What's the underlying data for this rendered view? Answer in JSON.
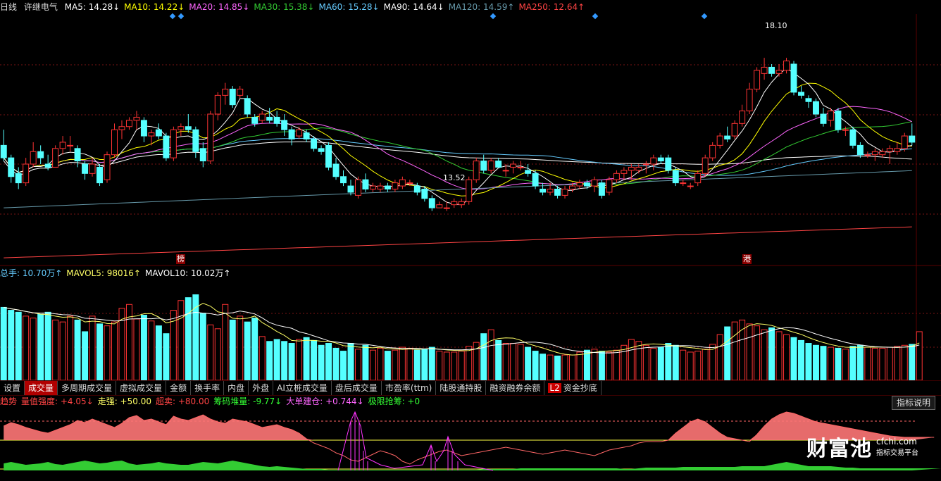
{
  "main_legend": {
    "label": "日线",
    "name": "许继电气",
    "items": [
      {
        "text": "MA5: 14.28↓",
        "color": "#ffffff"
      },
      {
        "text": "MA10: 14.22↓",
        "color": "#ffff00"
      },
      {
        "text": "MA20: 14.85↓",
        "color": "#ff66ff"
      },
      {
        "text": "MA30: 15.38↓",
        "color": "#33cc33"
      },
      {
        "text": "MA60: 15.28↓",
        "color": "#66ccff"
      },
      {
        "text": "MA90: 14.64↓",
        "color": "#ffffff"
      },
      {
        "text": "MA120: 14.59↑",
        "color": "#6699aa"
      },
      {
        "text": "MA250: 12.64↑",
        "color": "#ff4444"
      }
    ]
  },
  "markers": {
    "high": "18.10",
    "low": "13.52",
    "bang": "榜",
    "gang": "港"
  },
  "vol_legend": {
    "items": [
      {
        "text": "总手: 10.70万↑",
        "color": "#66ccff"
      },
      {
        "text": "MAVOL5: 98016↑",
        "color": "#ffff66"
      },
      {
        "text": "MAVOL10: 10.02万↑",
        "color": "#ffffff"
      }
    ]
  },
  "tabs": [
    "设置",
    "成交量",
    "多周期成交量",
    "虚拟成交量",
    "金额",
    "换手率",
    "内盘",
    "外盘",
    "AI立桩成交量",
    "盘后成交量",
    "市盈率(ttm)",
    "陆股通持股",
    "融资融券余额",
    "资金抄底"
  ],
  "tab_l2_badge": "L2",
  "ind_legend": {
    "items": [
      {
        "text": "趋势",
        "color": "#ff4444"
      },
      {
        "text": "量值强度: +4.05↓",
        "color": "#ff4444"
      },
      {
        "text": "走强: +50.00",
        "color": "#ffff66"
      },
      {
        "text": "超卖: +80.00",
        "color": "#ff4444"
      },
      {
        "text": "筹码堆量: -9.77↓",
        "color": "#33ff33"
      },
      {
        "text": "大单建仓: +0.744↓",
        "color": "#ff66ff"
      },
      {
        "text": "极限抢筹: +0",
        "color": "#33ff33"
      }
    ]
  },
  "help_button": "指标说明",
  "logo": {
    "brand": "财富池",
    "site": "cfchi.com",
    "slogan": "指标交易平台"
  },
  "colors": {
    "up": "#ff3333",
    "down": "#55ffff",
    "bg": "#000000"
  },
  "chart_data": [
    {
      "type": "candlestick",
      "title": "许继电气 日线",
      "ylim": [
        11.5,
        19.5
      ],
      "ohlc": [
        [
          15.3,
          15.8,
          14.8,
          14.9
        ],
        [
          14.9,
          15.0,
          14.1,
          14.3
        ],
        [
          14.4,
          14.6,
          13.9,
          14.1
        ],
        [
          14.1,
          14.9,
          14.0,
          14.7
        ],
        [
          14.7,
          15.4,
          14.6,
          15.1
        ],
        [
          15.1,
          15.3,
          14.7,
          14.9
        ],
        [
          14.7,
          15.0,
          14.5,
          14.6
        ],
        [
          14.6,
          15.3,
          14.6,
          15.2
        ],
        [
          15.2,
          15.6,
          15.0,
          15.4
        ],
        [
          15.3,
          15.6,
          15.1,
          15.3
        ],
        [
          15.2,
          15.3,
          14.6,
          14.8
        ],
        [
          14.7,
          14.8,
          14.2,
          14.4
        ],
        [
          14.4,
          14.9,
          14.3,
          14.7
        ],
        [
          14.6,
          14.7,
          14.0,
          14.1
        ],
        [
          14.2,
          15.1,
          14.1,
          15.0
        ],
        [
          15.0,
          16.0,
          14.9,
          15.8
        ],
        [
          15.8,
          16.1,
          15.5,
          15.9
        ],
        [
          15.9,
          16.2,
          15.8,
          16.1
        ],
        [
          16.1,
          16.4,
          15.8,
          16.2
        ],
        [
          16.1,
          16.2,
          15.4,
          15.6
        ],
        [
          15.6,
          15.8,
          15.3,
          15.7
        ],
        [
          15.8,
          16.0,
          15.5,
          15.6
        ],
        [
          15.6,
          15.7,
          14.8,
          14.9
        ],
        [
          14.9,
          15.9,
          14.8,
          15.8
        ],
        [
          15.8,
          16.0,
          15.6,
          15.9
        ],
        [
          15.9,
          16.3,
          15.7,
          15.8
        ],
        [
          15.8,
          15.9,
          14.9,
          15.1
        ],
        [
          15.2,
          15.4,
          14.6,
          14.8
        ],
        [
          14.8,
          16.4,
          14.7,
          16.3
        ],
        [
          16.3,
          17.0,
          16.1,
          16.9
        ],
        [
          16.9,
          17.3,
          16.6,
          17.1
        ],
        [
          17.1,
          17.2,
          16.5,
          16.6
        ],
        [
          16.9,
          17.2,
          16.8,
          17.1
        ],
        [
          16.8,
          16.9,
          16.2,
          16.3
        ],
        [
          16.2,
          16.3,
          15.9,
          16.0
        ],
        [
          16.1,
          16.4,
          16.0,
          16.3
        ],
        [
          16.2,
          16.5,
          16.0,
          16.1
        ],
        [
          16.2,
          16.4,
          15.9,
          16.0
        ],
        [
          16.1,
          16.3,
          15.6,
          15.8
        ],
        [
          15.8,
          15.9,
          15.3,
          15.5
        ],
        [
          15.6,
          15.9,
          15.5,
          15.8
        ],
        [
          15.7,
          15.8,
          15.4,
          15.5
        ],
        [
          15.5,
          15.6,
          15.1,
          15.2
        ],
        [
          15.2,
          15.3,
          15.0,
          15.1
        ],
        [
          15.3,
          15.4,
          14.5,
          14.6
        ],
        [
          14.7,
          14.9,
          14.2,
          14.3
        ],
        [
          14.3,
          14.5,
          14.0,
          14.1
        ],
        [
          14.0,
          14.2,
          13.7,
          13.8
        ],
        [
          13.7,
          14.3,
          13.6,
          14.2
        ],
        [
          14.2,
          14.4,
          13.8,
          13.9
        ],
        [
          13.9,
          14.1,
          13.8,
          14.0
        ],
        [
          13.9,
          14.1,
          13.8,
          14.0
        ],
        [
          14.0,
          14.1,
          13.8,
          13.9
        ],
        [
          13.9,
          14.2,
          13.8,
          14.1
        ],
        [
          14.0,
          14.3,
          13.9,
          14.2
        ],
        [
          14.1,
          14.2,
          14.0,
          14.1
        ],
        [
          14.0,
          14.1,
          13.7,
          13.8
        ],
        [
          13.9,
          14.0,
          13.5,
          13.6
        ],
        [
          13.6,
          13.7,
          13.2,
          13.3
        ],
        [
          13.3,
          13.5,
          13.3,
          13.4
        ],
        [
          13.3,
          13.5,
          13.2,
          13.3
        ],
        [
          13.4,
          13.6,
          13.3,
          13.5
        ],
        [
          13.4,
          13.6,
          13.3,
          13.5
        ],
        [
          13.5,
          14.3,
          13.4,
          14.2
        ],
        [
          14.2,
          14.9,
          14.1,
          14.8
        ],
        [
          14.8,
          15.0,
          14.4,
          14.5
        ],
        [
          14.5,
          14.9,
          14.4,
          14.8
        ],
        [
          14.8,
          14.9,
          14.6,
          14.6
        ],
        [
          14.5,
          14.7,
          14.3,
          14.5
        ],
        [
          14.6,
          14.8,
          14.4,
          14.7
        ],
        [
          14.6,
          14.8,
          14.5,
          14.6
        ],
        [
          14.5,
          14.7,
          14.3,
          14.4
        ],
        [
          14.4,
          14.5,
          13.9,
          14.0
        ],
        [
          13.9,
          14.1,
          13.7,
          13.8
        ],
        [
          13.8,
          14.1,
          13.7,
          13.9
        ],
        [
          13.9,
          14.0,
          13.6,
          13.7
        ],
        [
          13.7,
          14.0,
          13.6,
          13.9
        ],
        [
          13.9,
          14.1,
          13.8,
          14.0
        ],
        [
          14.0,
          14.2,
          13.9,
          14.1
        ],
        [
          14.1,
          14.2,
          13.9,
          14.0
        ],
        [
          14.0,
          14.3,
          13.8,
          14.2
        ],
        [
          14.1,
          14.2,
          13.6,
          13.7
        ],
        [
          13.8,
          14.3,
          13.7,
          14.2
        ],
        [
          14.2,
          14.5,
          14.1,
          14.4
        ],
        [
          14.4,
          14.6,
          14.2,
          14.5
        ],
        [
          14.5,
          14.7,
          14.2,
          14.6
        ],
        [
          14.5,
          14.7,
          14.4,
          14.6
        ],
        [
          14.7,
          14.8,
          14.4,
          14.7
        ],
        [
          14.7,
          15.0,
          14.5,
          14.9
        ],
        [
          14.9,
          15.0,
          14.7,
          14.8
        ],
        [
          14.9,
          15.0,
          14.4,
          14.5
        ],
        [
          14.5,
          14.6,
          14.0,
          14.1
        ],
        [
          14.1,
          14.2,
          14.0,
          14.1
        ],
        [
          14.0,
          14.1,
          13.9,
          14.0
        ],
        [
          14.1,
          14.5,
          14.0,
          14.4
        ],
        [
          14.4,
          15.0,
          14.3,
          14.9
        ],
        [
          14.9,
          15.4,
          14.8,
          15.3
        ],
        [
          15.3,
          15.7,
          15.2,
          15.6
        ],
        [
          15.6,
          15.9,
          15.4,
          15.5
        ],
        [
          15.6,
          16.1,
          15.5,
          16.0
        ],
        [
          16.0,
          16.6,
          15.9,
          16.4
        ],
        [
          16.4,
          17.3,
          16.3,
          17.1
        ],
        [
          17.1,
          17.8,
          17.0,
          17.7
        ],
        [
          17.6,
          18.1,
          17.4,
          17.8
        ],
        [
          17.8,
          17.9,
          17.5,
          17.6
        ],
        [
          17.6,
          17.9,
          17.5,
          17.7
        ],
        [
          17.7,
          18.1,
          17.6,
          18.0
        ],
        [
          17.9,
          18.0,
          16.9,
          17.0
        ],
        [
          17.0,
          17.2,
          16.8,
          16.9
        ],
        [
          16.8,
          16.9,
          16.5,
          16.7
        ],
        [
          16.7,
          16.8,
          16.2,
          16.3
        ],
        [
          16.3,
          16.5,
          15.9,
          16.0
        ],
        [
          16.1,
          16.5,
          15.9,
          16.4
        ],
        [
          16.4,
          16.5,
          15.7,
          15.8
        ],
        [
          15.8,
          15.9,
          15.6,
          15.8
        ],
        [
          15.8,
          15.9,
          15.2,
          15.3
        ],
        [
          15.3,
          15.4,
          14.9,
          15.0
        ],
        [
          15.0,
          15.1,
          14.9,
          15.0
        ],
        [
          15.0,
          15.2,
          14.8,
          15.1
        ],
        [
          15.0,
          15.2,
          14.9,
          15.1
        ],
        [
          15.1,
          15.3,
          14.7,
          15.2
        ],
        [
          15.1,
          15.4,
          15.0,
          15.2
        ],
        [
          15.2,
          15.7,
          15.1,
          15.6
        ],
        [
          15.6,
          16.0,
          15.3,
          15.4
        ]
      ]
    },
    {
      "type": "bar",
      "title": "总手",
      "values": [
        75,
        72,
        70,
        66,
        64,
        68,
        70,
        62,
        60,
        66,
        62,
        50,
        66,
        58,
        56,
        60,
        74,
        78,
        63,
        67,
        61,
        56,
        48,
        72,
        82,
        85,
        88,
        69,
        57,
        53,
        78,
        62,
        66,
        60,
        64,
        45,
        40,
        42,
        40,
        38,
        42,
        44,
        41,
        36,
        38,
        33,
        30,
        38,
        32,
        36,
        31,
        33,
        30,
        31,
        34,
        33,
        31,
        32,
        34,
        30,
        29,
        29,
        30,
        35,
        39,
        48,
        52,
        41,
        38,
        38,
        37,
        34,
        30,
        27,
        26,
        25,
        26,
        26,
        29,
        31,
        32,
        30,
        29,
        31,
        36,
        42,
        40,
        36,
        33,
        34,
        38,
        36,
        31,
        29,
        30,
        32,
        37,
        47,
        55,
        60,
        62,
        58,
        56,
        52,
        54,
        50,
        47,
        44,
        41,
        38,
        36,
        35,
        34,
        33,
        32,
        35,
        36,
        34,
        33,
        33,
        34,
        35,
        36,
        37,
        50
      ],
      "ylim": [
        0,
        105
      ]
    },
    {
      "type": "area",
      "title": "量值强度",
      "values": [
        20,
        25,
        22,
        18,
        15,
        12,
        10,
        14,
        18,
        22,
        28,
        25,
        30,
        26,
        22,
        18,
        24,
        32,
        35,
        28,
        30,
        26,
        22,
        34,
        30,
        28,
        32,
        36,
        30,
        26,
        24,
        30,
        28,
        26,
        22,
        18,
        20,
        22,
        18,
        15,
        10,
        2,
        -4,
        -8,
        -12,
        -18,
        -22,
        -28,
        -30,
        -25,
        -20,
        -15,
        -18,
        -22,
        -30,
        -34,
        -28,
        -24,
        -20,
        -16,
        -14,
        -18,
        -22,
        -20,
        -18,
        -16,
        -14,
        -12,
        -10,
        -12,
        -14,
        -16,
        -18,
        -20,
        -18,
        -16,
        -14,
        -16,
        -18,
        -20,
        -22,
        -18,
        -14,
        -12,
        -10,
        -8,
        -4,
        -2,
        -2,
        -2,
        0,
        10,
        18,
        26,
        30,
        26,
        18,
        10,
        4,
        2,
        0,
        -2,
        8,
        20,
        30,
        36,
        40,
        38,
        34,
        30,
        26,
        24,
        22,
        20,
        18,
        16,
        14,
        12,
        10,
        8,
        6,
        5,
        4,
        4,
        4,
        4,
        4
      ],
      "series": [
        {
          "name": "筹码堆量",
          "values": [
            10,
            12,
            10,
            8,
            9,
            10,
            12,
            9,
            8,
            10,
            12,
            14,
            12,
            10,
            11,
            13,
            14,
            10,
            8,
            9,
            10,
            12,
            10,
            9,
            8,
            8,
            10,
            12,
            11,
            10,
            12,
            14,
            12,
            10,
            8,
            6,
            5,
            6,
            5,
            4,
            3,
            2,
            2,
            2,
            1,
            1,
            1,
            1,
            1,
            1,
            1,
            1,
            1,
            1,
            1,
            1,
            1,
            1,
            1,
            1,
            1,
            1,
            1,
            1,
            1,
            2,
            2,
            2,
            2,
            2,
            3,
            3,
            3,
            3,
            3,
            3,
            3,
            3,
            3,
            3,
            3,
            3,
            3,
            3,
            2,
            2,
            3,
            4,
            4,
            4,
            4,
            4,
            5,
            5,
            5,
            5,
            5,
            5,
            5,
            5,
            6,
            6,
            6,
            6,
            8,
            10,
            12,
            10,
            8,
            6,
            6,
            6,
            6,
            5,
            4,
            4,
            3,
            3,
            3,
            3,
            3,
            3,
            3,
            3,
            3,
            3,
            3,
            3
          ]
        }
      ]
    }
  ]
}
